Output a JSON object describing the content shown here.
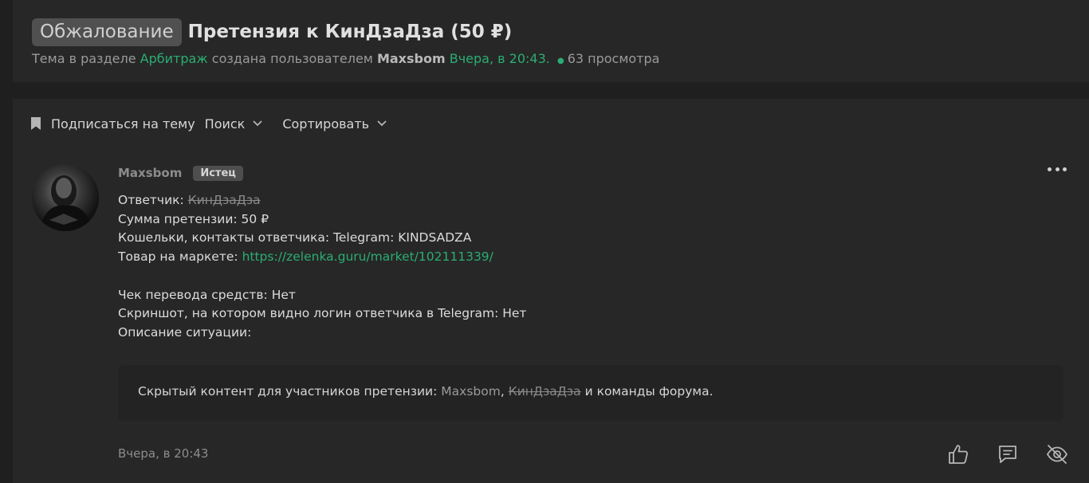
{
  "header": {
    "prefix": "Обжалование",
    "title": "Претензия к КинДзаДза (50 ₽)",
    "meta": {
      "before_section": "Тема в разделе",
      "section": "Арбитраж",
      "before_author": "создана пользователем",
      "author": "Maxsbom",
      "date": "Вчера, в 20:43.",
      "views": "63 просмотра"
    }
  },
  "toolbar": {
    "subscribe": "Подписаться на тему",
    "search": "Поиск",
    "sort": "Сортировать"
  },
  "post": {
    "author": "Maxsbom",
    "badge": "Истец",
    "lines": {
      "respondent_label": "Ответчик:",
      "respondent": "КинДзаДза",
      "amount": "Сумма претензии: 50 ₽",
      "contacts": "Кошельки, контакты ответчика: Telegram: KINDSADZA",
      "market_label": "Товар на маркете:",
      "market_link": "https://zelenka.guru/market/102111339/",
      "receipt": "Чек перевода средств: Нет",
      "screenshot": "Скриншот, на котором видно логин ответчика в Telegram: Нет",
      "description": "Описание ситуации:"
    },
    "hidden": {
      "text": "Скрытый контент для участников претензии:",
      "user1": "Maxsbom",
      "separator": ",",
      "user2": "КинДзаДза",
      "suffix": "и команды форума."
    },
    "date": "Вчера, в 20:43"
  },
  "icons": {
    "bookmark": "bookmark-icon",
    "chevron": "chevron-down-icon",
    "more": "more-options-icon",
    "like": "thumbs-up-icon",
    "reply": "reply-icon",
    "hide": "eye-off-icon"
  },
  "colors": {
    "accent_green": "#2bad72",
    "background": "#1f1f1f",
    "panel": "#272727"
  }
}
